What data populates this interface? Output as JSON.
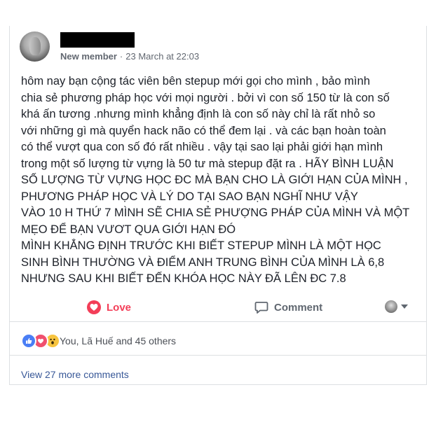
{
  "post": {
    "author_badge": "New member",
    "separator": "·",
    "timestamp": "23 March at 22:03",
    "body_lines": [
      "hôm nay bạn cộng tác viên bên stepup mới gọi cho mình , bảo mình",
      "chia sẻ phương pháp học với mọi người . bởi vì con số 150 từ là con số",
      "khá ấn tương .nhưng mình khẳng định là con số này chỉ là rất nhỏ so",
      "với những gì mà quyển hack não có thể đem lại . và các bạn hoàn toàn",
      "có thể vượt qua con số đó rất nhiều . vậy tại sao lại phải giới hạn mình",
      "trong một số lượng từ vựng là 50 tư mà stepup đặt ra . HÃY BÌNH LUẬN",
      "SỐ LƯỢNG TỪ VỰNG HỌC ĐC MÀ BẠN CHO LÀ GIỚI HẠN CỦA MÌNH ,",
      "PHƯƠNG PHÁP HỌC VÀ LÝ DO TẠI SAO BẠN NGHĨ NHƯ VẬY",
      "VÀO 10 H THỨ 7 MÌNH SẼ CHIA SẺ PHƯỢNG PHÁP CỦA MÌNH VÀ MỘT",
      "MẸO ĐỂ BẠN VƯƠT QUA GIỚI HẠN ĐÓ",
      "MÌNH KHẲNG ĐỊNH TRƯỚC KHI BIẾT STEPUP MÌNH LÀ MỘT HỌC",
      "SINH BÌNH THƯỜNG VÀ ĐIỂM ANH TRUNG BÌNH CỦA MÌNH LÀ 6,8",
      "NHƯNG SAU KHI BIẾT ĐẾN KHÓA HỌC NÀY ĐÃ LÊN ĐC 7.8"
    ]
  },
  "actions": {
    "love_label": "Love",
    "comment_label": "Comment"
  },
  "reactions": {
    "summary": "You, Lã Huế and 45 others",
    "icons": [
      "like-icon",
      "love-icon",
      "wow-icon"
    ]
  },
  "comments": {
    "view_more": "View 27 more comments"
  },
  "colors": {
    "love": "#f33e58",
    "link": "#385898",
    "text": "#1d2129",
    "meta": "#616770"
  }
}
